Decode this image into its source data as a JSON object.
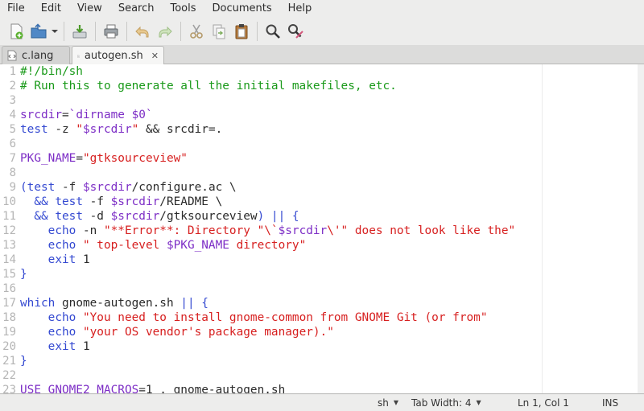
{
  "menubar": {
    "items": [
      "File",
      "Edit",
      "View",
      "Search",
      "Tools",
      "Documents",
      "Help"
    ]
  },
  "toolbar": {
    "buttons": [
      {
        "icon": "new-document-icon"
      },
      {
        "icon": "open-folder-icon"
      },
      {
        "icon": "save-icon"
      },
      {
        "icon": "print-icon"
      },
      {
        "icon": "undo-icon"
      },
      {
        "icon": "redo-icon"
      },
      {
        "icon": "cut-icon"
      },
      {
        "icon": "copy-icon"
      },
      {
        "icon": "paste-icon"
      },
      {
        "icon": "search-icon"
      },
      {
        "icon": "search-replace-icon"
      }
    ]
  },
  "tabs": [
    {
      "label": "c.lang",
      "active": false
    },
    {
      "label": "autogen.sh",
      "active": true
    }
  ],
  "editor": {
    "lines": [
      {
        "n": "1",
        "tokens": [
          {
            "t": "#!/bin/sh",
            "c": "t-comment"
          }
        ]
      },
      {
        "n": "2",
        "tokens": [
          {
            "t": "# Run this to generate all the initial makefiles, etc.",
            "c": "t-comment"
          }
        ]
      },
      {
        "n": "3",
        "tokens": []
      },
      {
        "n": "4",
        "tokens": [
          {
            "t": "srcdir",
            "c": "t-var"
          },
          {
            "t": "=",
            "c": ""
          },
          {
            "t": "`dirname ",
            "c": "t-var"
          },
          {
            "t": "$0",
            "c": "t-var"
          },
          {
            "t": "`",
            "c": "t-var"
          }
        ]
      },
      {
        "n": "5",
        "tokens": [
          {
            "t": "test",
            "c": "t-builtin"
          },
          {
            "t": " -z ",
            "c": ""
          },
          {
            "t": "\"",
            "c": "t-str"
          },
          {
            "t": "$srcdir",
            "c": "t-var"
          },
          {
            "t": "\"",
            "c": "t-str"
          },
          {
            "t": " && srcdir=.",
            "c": ""
          }
        ]
      },
      {
        "n": "6",
        "tokens": []
      },
      {
        "n": "7",
        "tokens": [
          {
            "t": "PKG_NAME",
            "c": "t-var"
          },
          {
            "t": "=",
            "c": ""
          },
          {
            "t": "\"gtksourceview\"",
            "c": "t-str"
          }
        ]
      },
      {
        "n": "8",
        "tokens": []
      },
      {
        "n": "9",
        "tokens": [
          {
            "t": "(",
            "c": "t-kw"
          },
          {
            "t": "test",
            "c": "t-builtin"
          },
          {
            "t": " -f ",
            "c": ""
          },
          {
            "t": "$srcdir",
            "c": "t-var"
          },
          {
            "t": "/configure.ac \\",
            "c": ""
          }
        ]
      },
      {
        "n": "10",
        "tokens": [
          {
            "t": "  && ",
            "c": "t-kw"
          },
          {
            "t": "test",
            "c": "t-builtin"
          },
          {
            "t": " -f ",
            "c": ""
          },
          {
            "t": "$srcdir",
            "c": "t-var"
          },
          {
            "t": "/README \\",
            "c": ""
          }
        ]
      },
      {
        "n": "11",
        "tokens": [
          {
            "t": "  && ",
            "c": "t-kw"
          },
          {
            "t": "test",
            "c": "t-builtin"
          },
          {
            "t": " -d ",
            "c": ""
          },
          {
            "t": "$srcdir",
            "c": "t-var"
          },
          {
            "t": "/gtksourceview",
            "c": ""
          },
          {
            "t": ") || {",
            "c": "t-kw"
          }
        ]
      },
      {
        "n": "12",
        "tokens": [
          {
            "t": "    ",
            "c": ""
          },
          {
            "t": "echo",
            "c": "t-builtin"
          },
          {
            "t": " -n ",
            "c": ""
          },
          {
            "t": "\"**Error**: Directory \"\\`",
            "c": "t-str"
          },
          {
            "t": "$srcdir",
            "c": "t-var"
          },
          {
            "t": "\\'\" does not look like the\"",
            "c": "t-str"
          }
        ]
      },
      {
        "n": "13",
        "tokens": [
          {
            "t": "    ",
            "c": ""
          },
          {
            "t": "echo",
            "c": "t-builtin"
          },
          {
            "t": " ",
            "c": ""
          },
          {
            "t": "\" top-level ",
            "c": "t-str"
          },
          {
            "t": "$PKG_NAME",
            "c": "t-var"
          },
          {
            "t": " directory\"",
            "c": "t-str"
          }
        ]
      },
      {
        "n": "14",
        "tokens": [
          {
            "t": "    ",
            "c": ""
          },
          {
            "t": "exit",
            "c": "t-builtin"
          },
          {
            "t": " 1",
            "c": ""
          }
        ]
      },
      {
        "n": "15",
        "tokens": [
          {
            "t": "}",
            "c": "t-kw"
          }
        ]
      },
      {
        "n": "16",
        "tokens": []
      },
      {
        "n": "17",
        "tokens": [
          {
            "t": "which",
            "c": "t-builtin"
          },
          {
            "t": " gnome-autogen.sh ",
            "c": ""
          },
          {
            "t": "|| {",
            "c": "t-kw"
          }
        ]
      },
      {
        "n": "18",
        "tokens": [
          {
            "t": "    ",
            "c": ""
          },
          {
            "t": "echo",
            "c": "t-builtin"
          },
          {
            "t": " ",
            "c": ""
          },
          {
            "t": "\"You need to install gnome-common from GNOME Git (or from\"",
            "c": "t-str"
          }
        ]
      },
      {
        "n": "19",
        "tokens": [
          {
            "t": "    ",
            "c": ""
          },
          {
            "t": "echo",
            "c": "t-builtin"
          },
          {
            "t": " ",
            "c": ""
          },
          {
            "t": "\"your OS vendor's package manager).\"",
            "c": "t-str"
          }
        ]
      },
      {
        "n": "20",
        "tokens": [
          {
            "t": "    ",
            "c": ""
          },
          {
            "t": "exit",
            "c": "t-builtin"
          },
          {
            "t": " 1",
            "c": ""
          }
        ]
      },
      {
        "n": "21",
        "tokens": [
          {
            "t": "}",
            "c": "t-kw"
          }
        ]
      },
      {
        "n": "22",
        "tokens": []
      },
      {
        "n": "23",
        "tokens": [
          {
            "t": "USE_GNOME2_MACROS",
            "c": "t-var"
          },
          {
            "t": "=1 . gnome-autogen.sh",
            "c": ""
          }
        ]
      }
    ]
  },
  "statusbar": {
    "language": "sh",
    "tab_width": "Tab Width: 4",
    "position": "Ln 1, Col 1",
    "mode": "INS"
  }
}
